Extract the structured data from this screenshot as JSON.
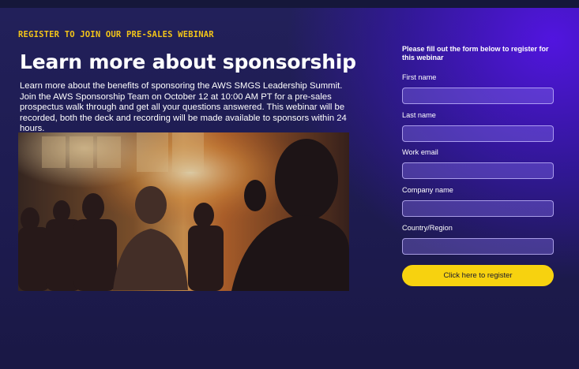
{
  "hero": {
    "eyebrow": "REGISTER TO JOIN OUR PRE-SALES WEBINAR",
    "title": "Learn more about sponsorship",
    "description": "Learn more about the benefits of sponsoring the AWS SMGS Leadership Summit. Join the AWS Sponsorship Team on October 12 at 10:00 AM PT for a pre-sales prospectus walk through and get all your questions answered. This webinar will be recorded, both the deck and recording will be made available to sponsors within 24 hours."
  },
  "form": {
    "intro": "Please fill out the form below to register for this webinar",
    "fields": [
      {
        "label": "First name",
        "value": ""
      },
      {
        "label": "Last name",
        "value": ""
      },
      {
        "label": "Work email",
        "value": ""
      },
      {
        "label": "Company name",
        "value": ""
      },
      {
        "label": "Country/Region",
        "value": ""
      }
    ],
    "submit_label": "Click here to register"
  },
  "colors": {
    "accent": "#f4c518",
    "button": "#f7d20f",
    "background": "#1d1b4f",
    "glow": "#5414e6"
  }
}
